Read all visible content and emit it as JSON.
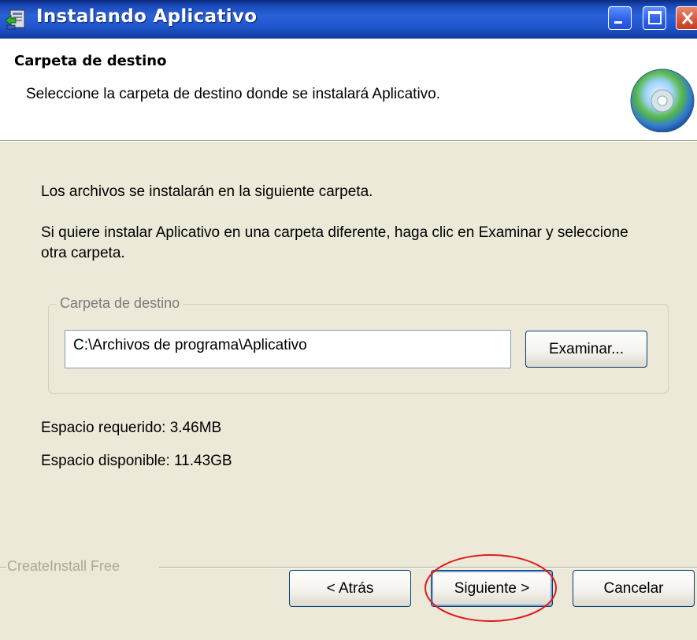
{
  "window": {
    "title": "Instalando Aplicativo",
    "controls": {
      "minimize": "minimize",
      "maximize": "maximize",
      "close": "close"
    }
  },
  "header": {
    "title": "Carpeta de destino",
    "subtitle": "Seleccione la carpeta de destino donde se instalará Aplicativo.",
    "icon": "cd-disc-icon"
  },
  "content": {
    "intro": "Los archivos se instalarán en la siguiente carpeta.",
    "instructions": "Si quiere instalar Aplicativo en una carpeta diferente, haga clic en Examinar y seleccione otra carpeta.",
    "destination_group": {
      "label": "Carpeta de destino",
      "path_value": "C:\\Archivos de programa\\Aplicativo",
      "browse_label": "Examinar..."
    },
    "space_required": "Espacio requerido: 3.46MB",
    "space_available": "Espacio disponible: 11.43GB"
  },
  "footer": {
    "brand": "CreateInstall Free",
    "back_label": "< Atrás",
    "next_label": "Siguiente >",
    "cancel_label": "Cancelar"
  },
  "colors": {
    "titlebar": "#2a62d8",
    "content_bg": "#ece9d8",
    "highlight": "#e11b1b"
  }
}
